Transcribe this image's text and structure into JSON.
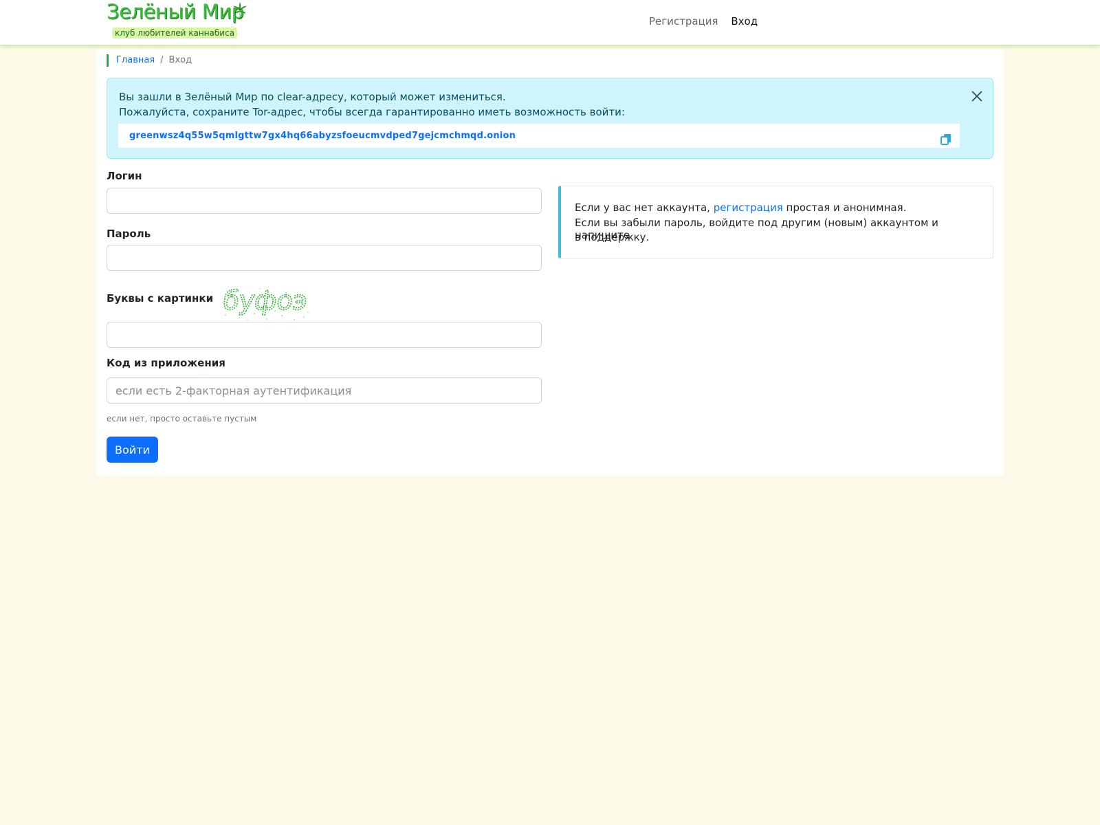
{
  "header": {
    "brand_title": "Зелёный Мир",
    "brand_subtitle": "клуб любителей каннабиса",
    "nav": {
      "register": "Регистрация",
      "login": "Вход"
    }
  },
  "breadcrumb": {
    "home": "Главная",
    "separator": "/",
    "current": "Вход"
  },
  "alert": {
    "line1": "Вы зашли в Зелёный Мир по clear-адресу, который может измениться.",
    "line2": "Пожалуйста, сохраните Tor-адрес, чтобы всегда гарантированно иметь возможность войти:",
    "onion_address": "greenwsz4q55w5qmlgttw7gx4hq66abyzsfoeucmvdped7gejcmchmqd.onion",
    "close_icon": "close-icon",
    "copy_icon": "copy-icon"
  },
  "form": {
    "login_label": "Логин",
    "password_label": "Пароль",
    "captcha_label": "Буквы с картинки",
    "captcha_text": "буфоэ",
    "code_label": "Код из приложения",
    "code_placeholder": "если есть 2-факторная аутентификация",
    "code_hint": "если нет, просто оставьте пустым",
    "submit_label": "Войти"
  },
  "info": {
    "line1_before": "Если у вас нет аккаунта, ",
    "line1_link": "регистрация",
    "line1_after": " простая и анонимная.",
    "line2": "Если вы забыли пароль, войдите под другим (новым) аккаунтом и напишите",
    "line3": "в поддержку."
  },
  "colors": {
    "page_background": "#fdf9e8",
    "accent_green": "#3cbf3c",
    "link_blue": "#0d6efd",
    "alert_background": "#cff4fc",
    "info_border": "#3bbfd9"
  }
}
